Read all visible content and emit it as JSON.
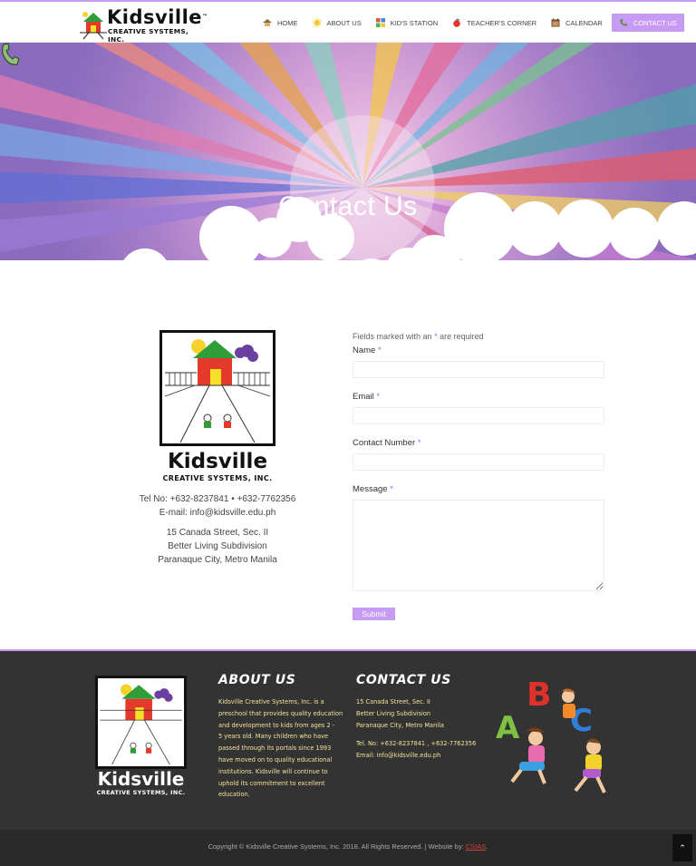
{
  "header": {
    "brand": "Kidsville",
    "brand_tm": "™",
    "brand_sub": "CREATIVE SYSTEMS, INC."
  },
  "nav": {
    "items": [
      {
        "label": "HOME",
        "icon": "house-icon"
      },
      {
        "label": "ABOUT US",
        "icon": "sun-icon"
      },
      {
        "label": "KID'S STATION",
        "icon": "blocks-icon"
      },
      {
        "label": "TEACHER'S CORNER",
        "icon": "apple-icon"
      },
      {
        "label": "CALENDAR",
        "icon": "calendar-icon"
      },
      {
        "label": "CONTACT US",
        "icon": "phone-icon",
        "active": true
      }
    ]
  },
  "hero": {
    "title": "Contact Us",
    "icon": "phone-icon"
  },
  "contact": {
    "brand": "Kidsville",
    "brand_sub": "CREATIVE SYSTEMS, INC.",
    "tel": "Tel No: +632-8237841 • +632-7762356",
    "email": "E-mail: info@kidsville.edu.ph",
    "address_line1": "15 Canada Street, Sec. II",
    "address_line2": "Better Living Subdivision",
    "address_line3": "Paranaque City, Metro Manila"
  },
  "form": {
    "note_before": "Fields marked with an",
    "note_star": "*",
    "note_after": "are required",
    "name_label": "Name",
    "email_label": "Email",
    "contact_label": "Contact Number",
    "message_label": "Message",
    "required_marker": "*",
    "submit_label": "Submit"
  },
  "footer": {
    "brand": "Kidsville",
    "brand_sub": "CREATIVE SYSTEMS, INC.",
    "about_heading": "ABOUT US",
    "about_lines": [
      "Kidsville Creative Systems, Inc. is a",
      "preschool that provides quality education",
      "and development to kids from ages 2 -",
      "5 years old. Many children who have",
      "passed through its portals since 1993",
      "have moved on to quality educational",
      "institutions. Kidsville will continue to",
      "uphold its commitment to excellent",
      "education."
    ],
    "contact_heading": "CONTACT US",
    "contact_lines": [
      "15 Canada Street, Sec. II",
      "Better Living Subdivision",
      "Paranaque City, Metro Manila",
      "",
      "Tel. No: +632-8237841 , +632-7762356",
      "Email: info@kidsville.edu.ph"
    ]
  },
  "bottom": {
    "copyright": "Copyright © Kidsville Creative Systems, Inc. 2018. All Rights Reserved. | Website by:",
    "credit": "CSIAS",
    "credit_end": ".",
    "to_top": "⌃"
  },
  "colors": {
    "accent": "#c79af3",
    "footer_bg": "#333333",
    "footer_text": "#f3e39a",
    "required": "#b25ee0"
  }
}
